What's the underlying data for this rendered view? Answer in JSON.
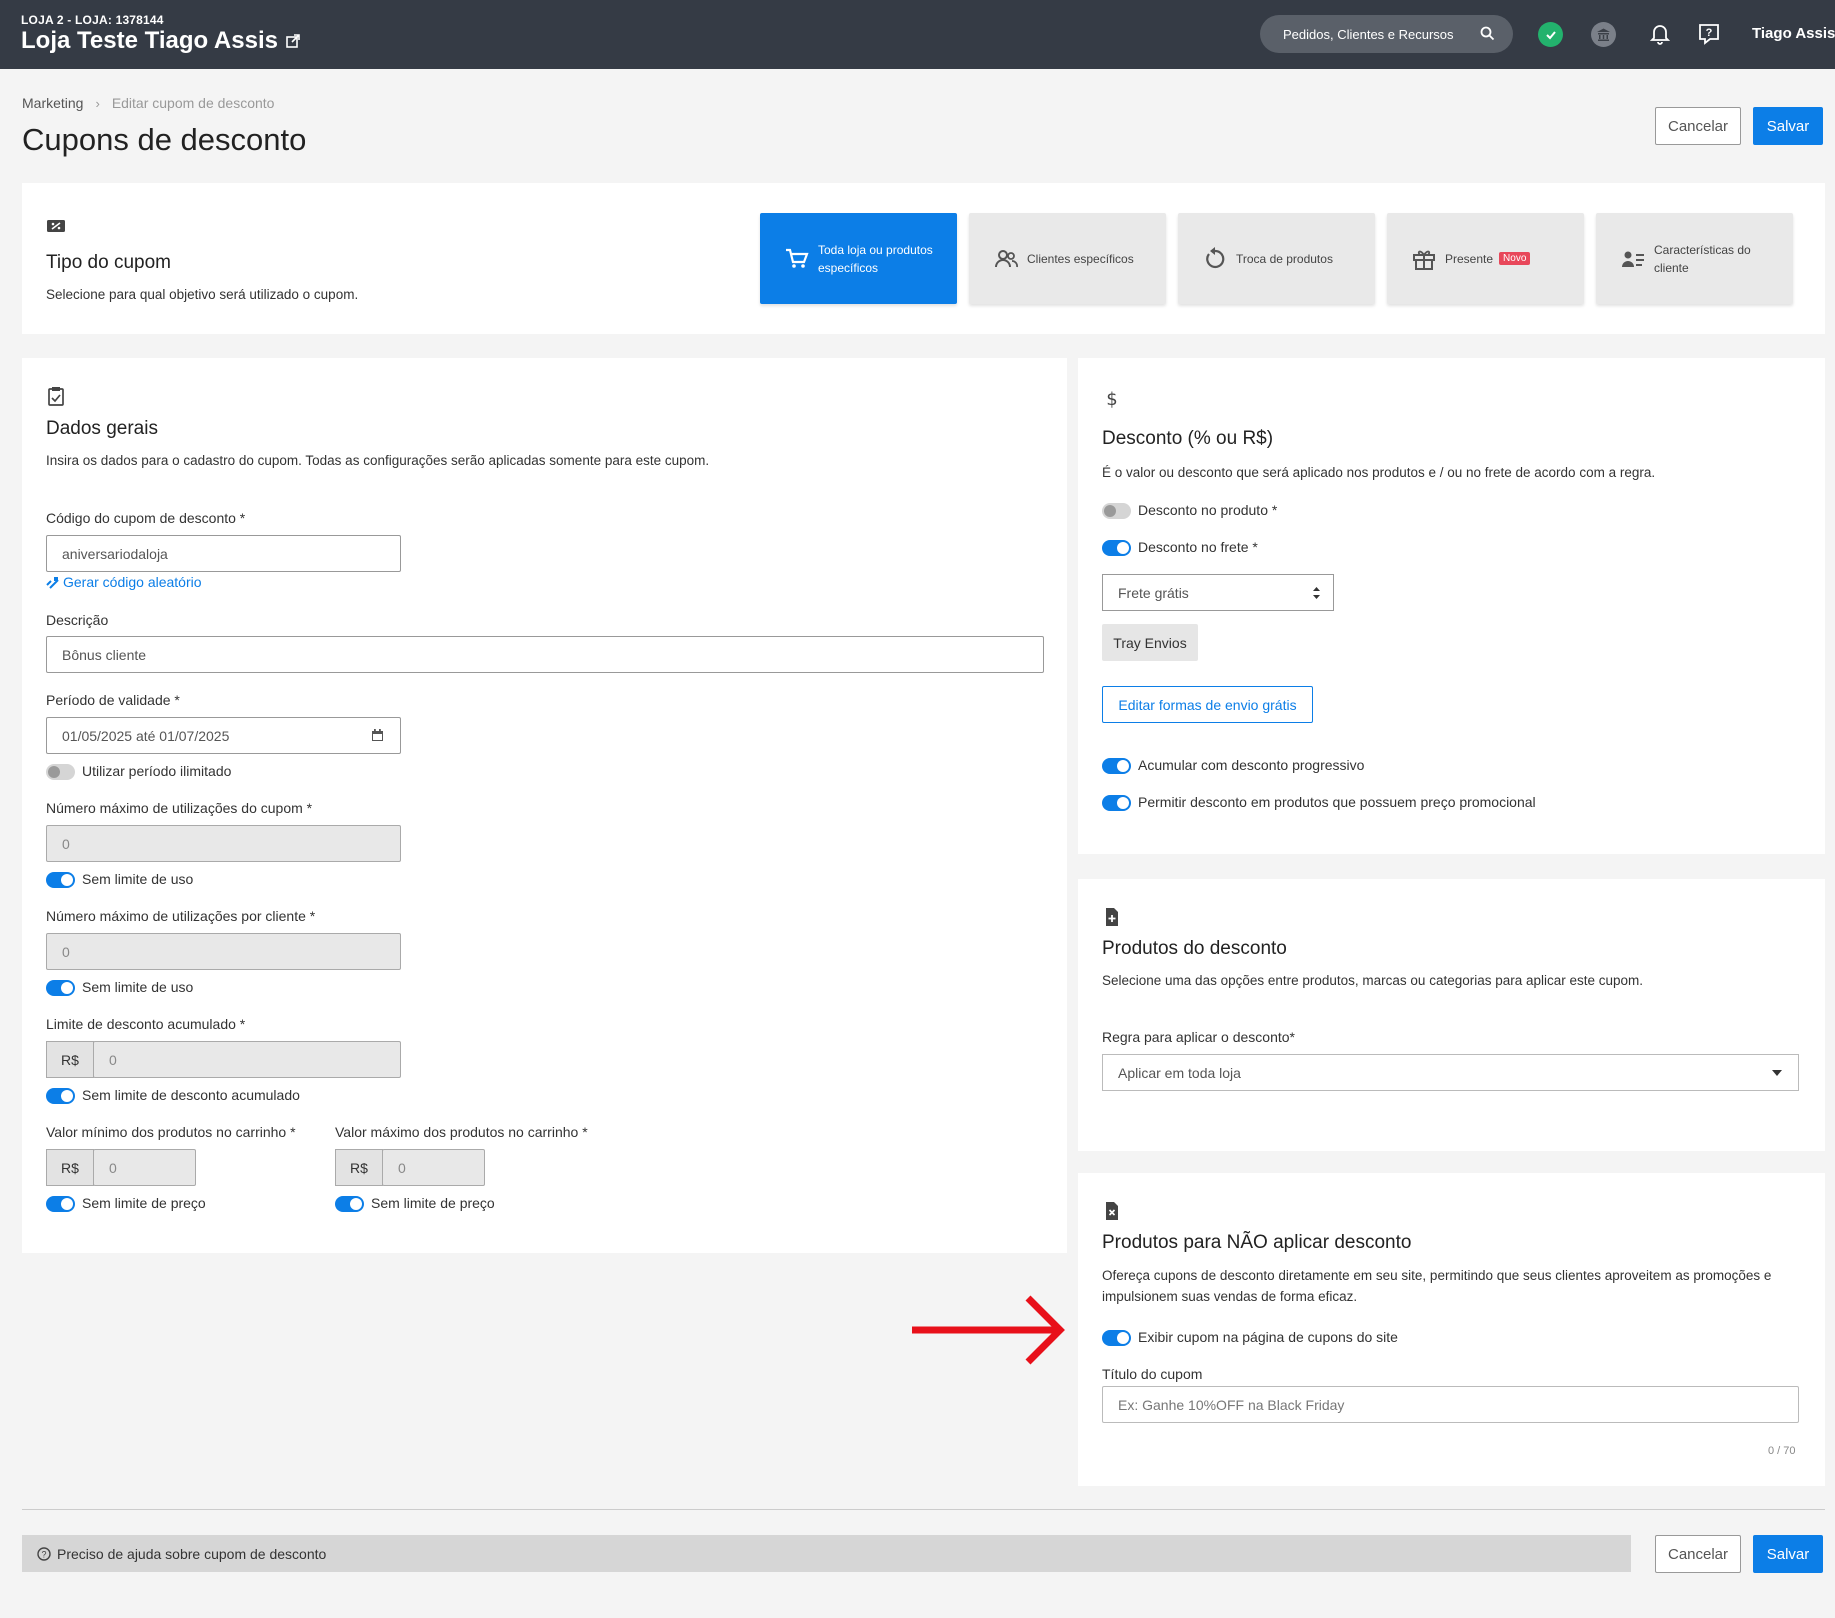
{
  "topbar": {
    "store_sub": "LOJA 2 - LOJA: 1378144",
    "store_title": "Loja Teste Tiago Assis",
    "search_label": "Pedidos, Clientes e Recursos",
    "user_name": "Tiago Assis"
  },
  "breadcrumb": {
    "parent": "Marketing",
    "current": "Editar cupom de desconto"
  },
  "page_title": "Cupons de desconto",
  "actions": {
    "cancel": "Cancelar",
    "save": "Salvar"
  },
  "tipo_cupom": {
    "title": "Tipo do cupom",
    "desc": "Selecione para qual objetivo será utilizado o cupom.",
    "options": [
      {
        "label": "Toda loja ou produtos específicos",
        "icon": "cart-icon",
        "active": true
      },
      {
        "label": "Clientes específicos",
        "icon": "users-icon"
      },
      {
        "label": "Troca de produtos",
        "icon": "refresh-icon"
      },
      {
        "label": "Presente",
        "icon": "gift-icon",
        "badge": "Novo"
      },
      {
        "label": "Características do cliente",
        "icon": "user-list-icon"
      }
    ]
  },
  "dados_gerais": {
    "title": "Dados gerais",
    "desc": "Insira os dados para o cadastro do cupom. Todas as configurações serão aplicadas somente para este cupom.",
    "codigo_label": "Código do cupom de desconto *",
    "codigo_value": "aniversariodaloja",
    "gerar_link": "Gerar código aleatório",
    "descricao_label": "Descrição",
    "descricao_value": "Bônus cliente",
    "periodo_label": "Período de validade *",
    "periodo_value": "01/05/2025 até 01/07/2025",
    "periodo_toggle": "Utilizar período ilimitado",
    "max_uso_label": "Número máximo de utilizações do cupom *",
    "max_uso_value": "0",
    "max_uso_toggle": "Sem limite de uso",
    "max_cliente_label": "Número máximo de utilizações por cliente *",
    "max_cliente_value": "0",
    "max_cliente_toggle": "Sem limite de uso",
    "limite_label": "Limite de desconto acumulado *",
    "limite_currency": "R$",
    "limite_value": "0",
    "limite_toggle": "Sem limite de desconto acumulado",
    "min_label": "Valor mínimo dos produtos no carrinho *",
    "min_currency": "R$",
    "min_value": "0",
    "min_toggle": "Sem limite de preço",
    "max_label": "Valor máximo dos produtos no carrinho *",
    "max_currency": "R$",
    "max_value": "0",
    "max_toggle": "Sem limite de preço"
  },
  "desconto": {
    "title": "Desconto (% ou R$)",
    "desc": "É o valor ou desconto que será aplicado nos produtos e / ou no frete de acordo com a regra.",
    "produto_toggle": "Desconto no produto *",
    "frete_toggle": "Desconto no frete *",
    "frete_select": "Frete grátis",
    "tray_envios": "Tray Envios",
    "editar_formas": "Editar formas de envio grátis",
    "acumular_toggle": "Acumular com desconto progressivo",
    "promocional_toggle": "Permitir desconto em produtos que possuem preço promocional"
  },
  "produtos_desconto": {
    "title": "Produtos do desconto",
    "desc": "Selecione uma das opções entre produtos, marcas ou categorias para aplicar este cupom.",
    "regra_label": "Regra para aplicar o desconto*",
    "regra_value": "Aplicar em toda loja"
  },
  "produtos_nao": {
    "title": "Produtos para NÃO aplicar desconto",
    "desc": "Ofereça cupons de desconto diretamente em seu site, permitindo que seus clientes aproveitem as promoções e impulsionem suas vendas de forma eficaz.",
    "exibir_toggle": "Exibir cupom na página de cupons do site",
    "titulo_label": "Título do cupom",
    "titulo_placeholder": "Ex: Ganhe 10%OFF na Black Friday",
    "counter": "0 / 70"
  },
  "help_bar": "Preciso de ajuda sobre cupom de desconto",
  "colors": {
    "primary": "#0c7ee7",
    "topbar": "#353b45",
    "success": "#23b26d",
    "arrow": "#e8101a",
    "badge": "#e8475a"
  }
}
